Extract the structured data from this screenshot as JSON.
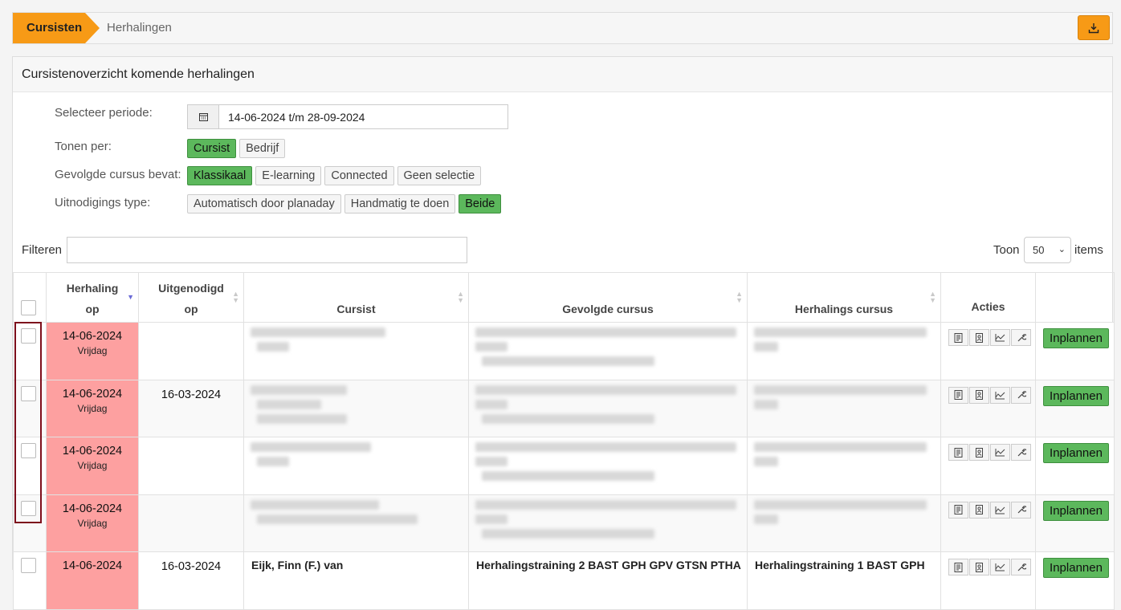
{
  "breadcrumb": {
    "active": "Cursisten",
    "next": "Herhalingen"
  },
  "panel": {
    "title": "Cursistenoverzicht komende herhalingen"
  },
  "form": {
    "periode_label": "Selecteer periode:",
    "periode_value": "14-06-2024 t/m 28-09-2024",
    "tonen_label": "Tonen per:",
    "tonen_options": [
      "Cursist",
      "Bedrijf"
    ],
    "cursus_label": "Gevolgde cursus bevat:",
    "cursus_options": [
      "Klassikaal",
      "E-learning",
      "Connected",
      "Geen selectie"
    ],
    "uitnodiging_label": "Uitnodigings type:",
    "uitnodiging_options": [
      "Automatisch door planaday",
      "Handmatig te doen",
      "Beide"
    ]
  },
  "filter": {
    "label": "Filteren",
    "value": ""
  },
  "pager": {
    "toon_label": "Toon",
    "page_size": "50",
    "items_label": "items"
  },
  "table": {
    "headers": {
      "herhaling_line1": "Herhaling",
      "herhaling_line2": "op",
      "uitgenodigd_line1": "Uitgenodigd",
      "uitgenodigd_line2": "op",
      "cursist": "Cursist",
      "gevolgde": "Gevolgde cursus",
      "herhalings": "Herhalings cursus",
      "acties": "Acties"
    },
    "rows": [
      {
        "date": "14-06-2024",
        "day": "Vrijdag",
        "invited": ""
      },
      {
        "date": "14-06-2024",
        "day": "Vrijdag",
        "invited": "16-03-2024"
      },
      {
        "date": "14-06-2024",
        "day": "Vrijdag",
        "invited": ""
      },
      {
        "date": "14-06-2024",
        "day": "Vrijdag",
        "invited": ""
      },
      {
        "date": "14-06-2024",
        "day": "",
        "invited": "16-03-2024",
        "cursist": "Eijk, Finn (F.) van",
        "gevolgde": "Herhalingstraining 2 BAST GPH GPV GTSN PTHA",
        "herhalings": "Herhalingstraining 1 BAST GPH"
      }
    ],
    "plan_label": "Inplannen"
  },
  "colors": {
    "accent": "#f79a16",
    "green": "#5cb85c",
    "overdue": "#fda0a0",
    "highlight": "#7d0f1c"
  }
}
